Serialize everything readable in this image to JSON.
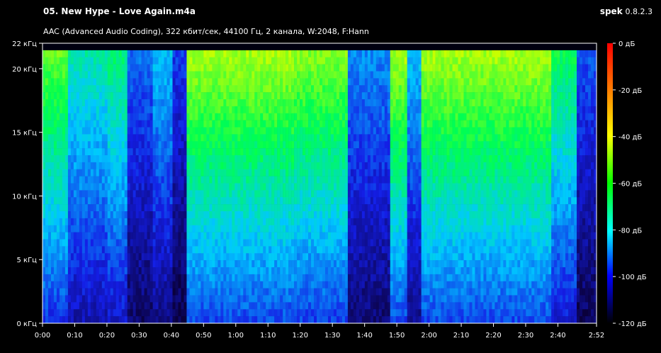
{
  "header": {
    "file_title": "05. New Hype - Love Again.m4a",
    "app_name": "spek",
    "app_version": "0.8.2.3",
    "info": "AAC (Advanced Audio Coding), 322 кбит/сек, 44100 Гц, 2 канала, W:2048, F:Hann"
  },
  "freq_axis": {
    "ticks": [
      {
        "value": 0,
        "label": "0 кГц"
      },
      {
        "value": 5,
        "label": "5 кГц"
      },
      {
        "value": 10,
        "label": "10 кГц"
      },
      {
        "value": 15,
        "label": "15 кГц"
      },
      {
        "value": 20,
        "label": "20 кГц"
      },
      {
        "value": 22,
        "label": "22 кГц"
      }
    ],
    "max": 22
  },
  "time_axis": {
    "ticks": [
      {
        "value": 0,
        "label": "0:00"
      },
      {
        "value": 10,
        "label": "0:10"
      },
      {
        "value": 20,
        "label": "0:20"
      },
      {
        "value": 30,
        "label": "0:30"
      },
      {
        "value": 40,
        "label": "0:40"
      },
      {
        "value": 50,
        "label": "0:50"
      },
      {
        "value": 60,
        "label": "1:00"
      },
      {
        "value": 70,
        "label": "1:10"
      },
      {
        "value": 80,
        "label": "1:20"
      },
      {
        "value": 90,
        "label": "1:30"
      },
      {
        "value": 100,
        "label": "1:40"
      },
      {
        "value": 110,
        "label": "1:50"
      },
      {
        "value": 120,
        "label": "2:00"
      },
      {
        "value": 130,
        "label": "2:10"
      },
      {
        "value": 140,
        "label": "2:20"
      },
      {
        "value": 150,
        "label": "2:30"
      },
      {
        "value": 160,
        "label": "2:40"
      },
      {
        "value": 172,
        "label": "2:52"
      }
    ],
    "max": 172
  },
  "db_scale": {
    "ticks": [
      {
        "value": 0,
        "label": "0 дБ"
      },
      {
        "value": -20,
        "label": "-20 дБ"
      },
      {
        "value": -40,
        "label": "-40 дБ"
      },
      {
        "value": -60,
        "label": "-60 дБ"
      },
      {
        "value": -80,
        "label": "-80 дБ"
      },
      {
        "value": -100,
        "label": "-100 дБ"
      },
      {
        "value": -120,
        "label": "-120 дБ"
      }
    ],
    "min": -120,
    "colors": [
      "#ff0000",
      "#ff8000",
      "#ffff00",
      "#00ff00",
      "#00ffff",
      "#0000ff",
      "#000000"
    ]
  },
  "spectrogram_energy": {
    "bands_description_note": "",
    "segments": [
      {
        "t0": 0,
        "t1": 8,
        "level": 0.75
      },
      {
        "t0": 8,
        "t1": 20,
        "level": 0.45
      },
      {
        "t0": 20,
        "t1": 26,
        "level": 0.55
      },
      {
        "t0": 26,
        "t1": 34,
        "level": 0.15
      },
      {
        "t0": 34,
        "t1": 40,
        "level": 0.3
      },
      {
        "t0": 40,
        "t1": 45,
        "level": 0.05
      },
      {
        "t0": 45,
        "t1": 78,
        "level": 0.85
      },
      {
        "t0": 78,
        "t1": 95,
        "level": 0.8
      },
      {
        "t0": 95,
        "t1": 108,
        "level": 0.2
      },
      {
        "t0": 108,
        "t1": 113,
        "level": 0.85
      },
      {
        "t0": 113,
        "t1": 118,
        "level": 0.3
      },
      {
        "t0": 118,
        "t1": 158,
        "level": 0.85
      },
      {
        "t0": 158,
        "t1": 166,
        "level": 0.6
      },
      {
        "t0": 166,
        "t1": 172,
        "level": 0.1
      }
    ]
  }
}
